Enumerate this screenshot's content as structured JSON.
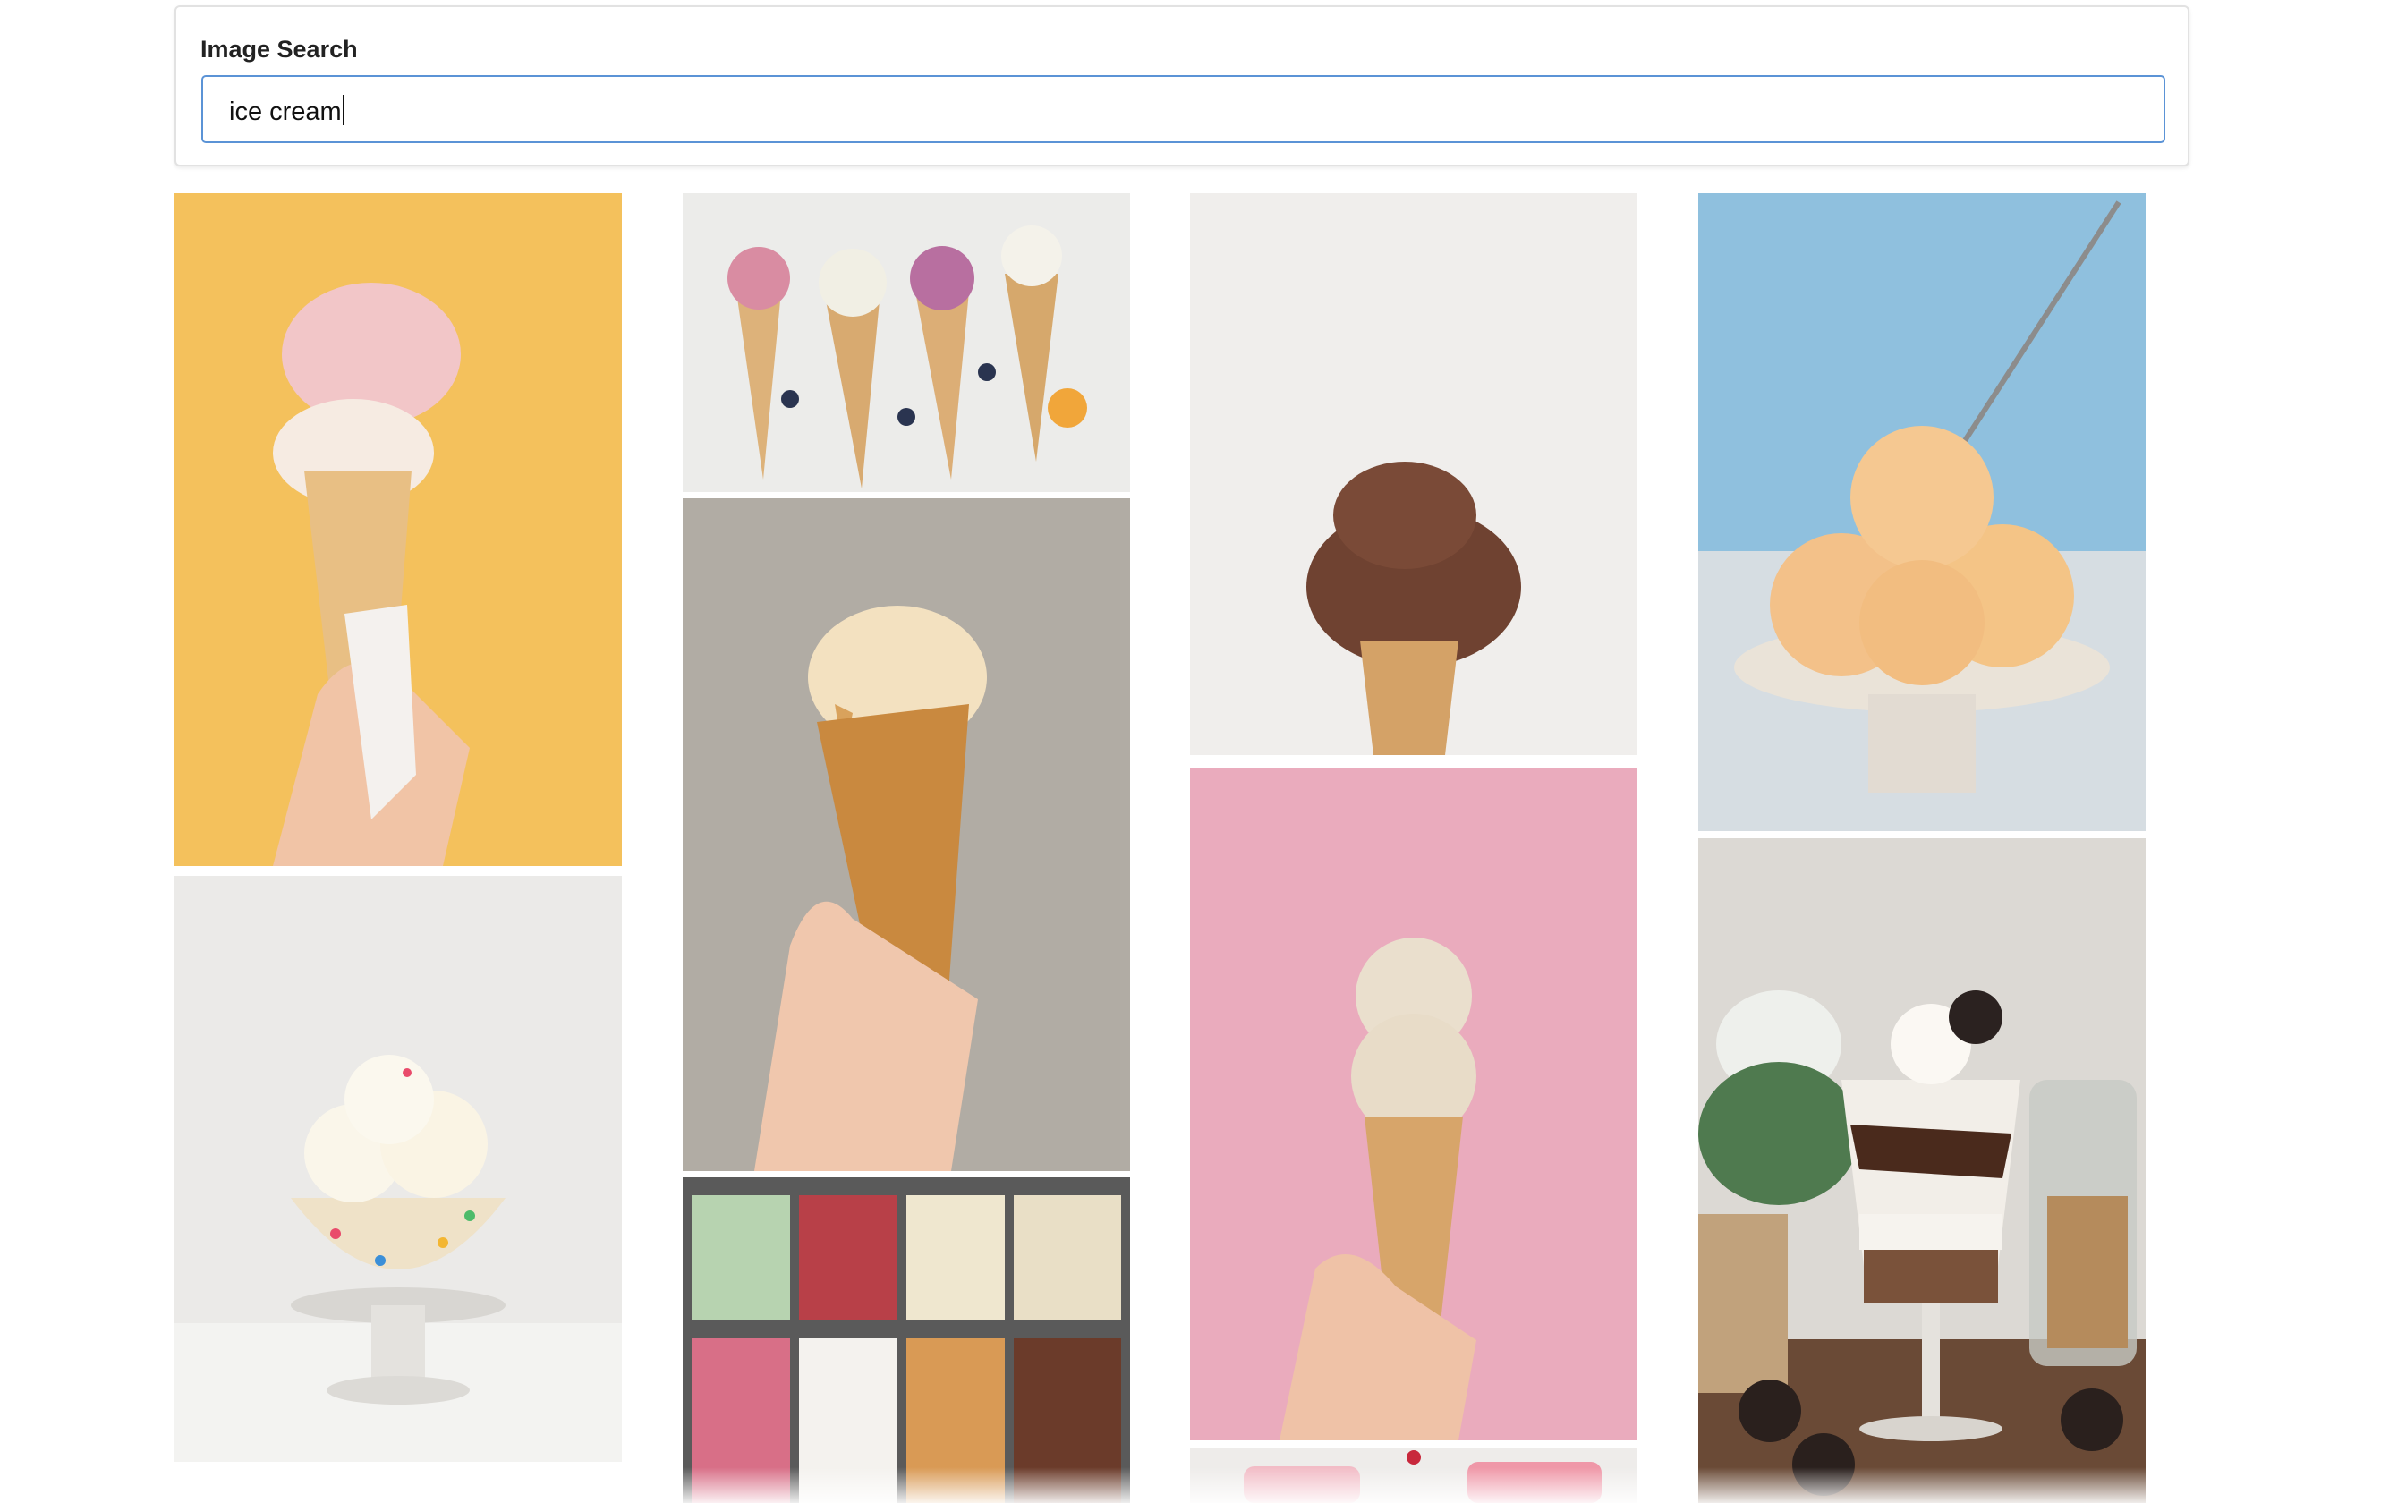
{
  "search": {
    "label": "Image Search",
    "value": "ice cream"
  },
  "results": [
    {
      "name": "pink-scoop-cone-hand",
      "column": 1
    },
    {
      "name": "sprinkle-bowl-vanilla-scoops",
      "column": 1
    },
    {
      "name": "blueberry-flower-cones",
      "column": 2
    },
    {
      "name": "melting-caramel-cone-hand",
      "column": 2
    },
    {
      "name": "gelato-display-case",
      "column": 2
    },
    {
      "name": "chocolate-scoop-cone",
      "column": 3
    },
    {
      "name": "vanilla-double-scoop-pink-background",
      "column": 3
    },
    {
      "name": "popsicles-on-marble",
      "column": 3
    },
    {
      "name": "peach-scoops-on-stand-spoon",
      "column": 4
    },
    {
      "name": "oreo-chocolate-parfait",
      "column": 4
    }
  ],
  "colors": {
    "input_border": "#5b93d6",
    "card_border": "#e2e2e2"
  }
}
